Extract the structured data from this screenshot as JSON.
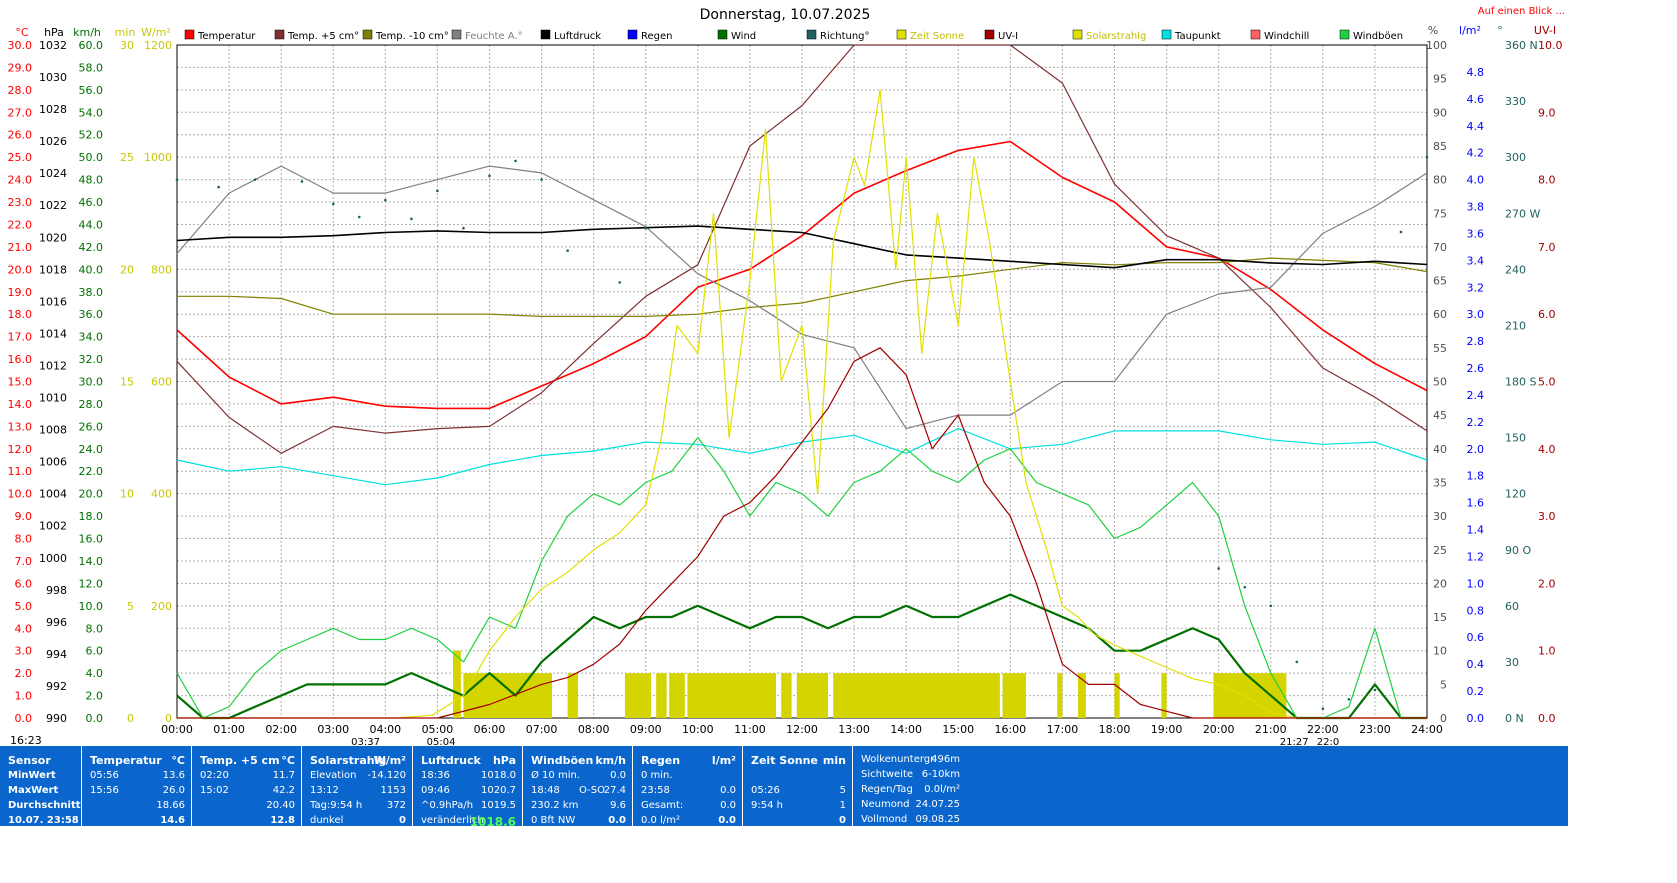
{
  "chart_data": {
    "type": "line",
    "title": "Donnerstag, 10.07.2025",
    "link": "Auf einen Blick ...",
    "time_ticks": [
      "00:00",
      "01:00",
      "02:00",
      "03:00",
      "04:00",
      "05:00",
      "06:00",
      "07:00",
      "08:00",
      "09:00",
      "10:00",
      "11:00",
      "12:00",
      "13:00",
      "14:00",
      "15:00",
      "16:00",
      "17:00",
      "18:00",
      "19:00",
      "20:00",
      "21:00",
      "22:00",
      "23:00",
      "24:00"
    ],
    "axes": {
      "temp": {
        "unit": "°C",
        "min": 0,
        "max": 30,
        "step": 1,
        "color": "#ff0000"
      },
      "pressure": {
        "unit": "hPa",
        "min": 990,
        "max": 1032,
        "step": 2,
        "color": "#000000"
      },
      "wind": {
        "unit": "km/h",
        "min": 0,
        "max": 60,
        "step": 2,
        "color": "#007000"
      },
      "sun_min": {
        "unit": "min",
        "min": 0,
        "max": 30,
        "step": 5,
        "color": "#c8c800"
      },
      "solar": {
        "unit": "W/m²",
        "min": 0,
        "max": 1200,
        "step": 200,
        "color": "#c8c800"
      },
      "humidity": {
        "unit": "%",
        "min": 0,
        "max": 100,
        "step": 5,
        "color": "#505050"
      },
      "rain": {
        "unit": "l/m²",
        "min": 0,
        "max": 5,
        "step": 0.2,
        "color": "#0000ff"
      },
      "direction": {
        "unit": "°",
        "ticks": [
          {
            "v": 0,
            "l": "0 N"
          },
          {
            "v": 30,
            "l": "30"
          },
          {
            "v": 60,
            "l": "60"
          },
          {
            "v": 90,
            "l": "90 O"
          },
          {
            "v": 120,
            "l": "120"
          },
          {
            "v": 150,
            "l": "150"
          },
          {
            "v": 180,
            "l": "180 S"
          },
          {
            "v": 210,
            "l": "210"
          },
          {
            "v": 240,
            "l": "240"
          },
          {
            "v": 270,
            "l": "270 W"
          },
          {
            "v": 300,
            "l": "300"
          },
          {
            "v": 330,
            "l": "330"
          },
          {
            "v": 360,
            "l": "360 N"
          }
        ],
        "color": "#206060"
      },
      "uv": {
        "unit": "UV-I",
        "min": 0,
        "max": 10,
        "step": 1,
        "color": "#a00000"
      }
    },
    "legend": [
      {
        "name": "Temperatur",
        "color": "#ff0000"
      },
      {
        "name": "Temp. +5 cm°",
        "color": "#803030"
      },
      {
        "name": "Temp. -10 cm°",
        "color": "#808000"
      },
      {
        "name": "Feuchte A.°",
        "color": "#808080"
      },
      {
        "name": "Luftdruck",
        "color": "#000000"
      },
      {
        "name": "Regen",
        "color": "#0000ff"
      },
      {
        "name": "Wind",
        "color": "#007000"
      },
      {
        "name": "Richtung°",
        "color": "#206060"
      },
      {
        "name": "Zeit Sonne",
        "color": "#e0e000"
      },
      {
        "name": "UV-I",
        "color": "#a00000"
      },
      {
        "name": "Solarstrahlg",
        "color": "#e0e000"
      },
      {
        "name": "Taupunkt",
        "color": "#00e0e0"
      },
      {
        "name": "Windchill",
        "color": "#ff6060"
      },
      {
        "name": "Windböen",
        "color": "#20d040"
      }
    ],
    "series": [
      {
        "name": "Temperatur",
        "axis": "temp",
        "x": [
          0,
          1,
          2,
          3,
          4,
          5,
          6,
          7,
          8,
          9,
          10,
          11,
          12,
          13,
          14,
          15,
          16,
          17,
          18,
          19,
          20,
          21,
          22,
          23,
          24
        ],
        "values": [
          17.3,
          15.2,
          14.0,
          14.3,
          13.9,
          13.8,
          13.8,
          14.8,
          15.8,
          17.0,
          19.2,
          20.0,
          21.5,
          23.4,
          24.4,
          25.3,
          25.7,
          24.1,
          23.0,
          21.0,
          20.5,
          19.1,
          17.3,
          15.8,
          14.6
        ]
      },
      {
        "name": "Temp. +5 cm°",
        "axis": "temp",
        "x": [
          0,
          1,
          2,
          3,
          4,
          5,
          6,
          7,
          8,
          9,
          10,
          11,
          12,
          13,
          14,
          15,
          16,
          17,
          18,
          19,
          20,
          21,
          22,
          23,
          24
        ],
        "values": [
          15.9,
          13.4,
          11.8,
          13.0,
          12.7,
          12.9,
          13.0,
          14.5,
          16.7,
          18.8,
          20.2,
          25.5,
          27.3,
          30.0,
          30.0,
          30.0,
          30.0,
          28.3,
          23.8,
          21.5,
          20.5,
          18.3,
          15.6,
          14.3,
          12.8
        ]
      },
      {
        "name": "Temp. -10 cm°",
        "axis": "temp",
        "x": [
          0,
          1,
          2,
          3,
          4,
          5,
          6,
          7,
          8,
          9,
          10,
          11,
          12,
          13,
          14,
          15,
          16,
          17,
          18,
          19,
          20,
          21,
          22,
          23,
          24
        ],
        "values": [
          18.8,
          18.8,
          18.7,
          18.0,
          18.0,
          18.0,
          18.0,
          17.9,
          17.9,
          17.9,
          18.0,
          18.3,
          18.5,
          19.0,
          19.5,
          19.7,
          20.0,
          20.3,
          20.2,
          20.3,
          20.3,
          20.5,
          20.4,
          20.3,
          19.9
        ]
      },
      {
        "name": "Feuchte A.°",
        "axis": "humidity",
        "x": [
          0,
          1,
          2,
          3,
          4,
          5,
          6,
          7,
          8,
          9,
          10,
          11,
          12,
          13,
          14,
          15,
          16,
          17,
          18,
          19,
          20,
          21,
          22,
          23,
          24
        ],
        "values": [
          69,
          78,
          82,
          78,
          78,
          80,
          82,
          81,
          77,
          73,
          66,
          62,
          57,
          55,
          43,
          45,
          45,
          50,
          50,
          60,
          63,
          64,
          72,
          76,
          81
        ]
      },
      {
        "name": "Luftdruck",
        "axis": "pressure",
        "x": [
          0,
          1,
          2,
          3,
          4,
          5,
          6,
          7,
          8,
          9,
          10,
          11,
          12,
          13,
          14,
          15,
          16,
          17,
          18,
          19,
          20,
          21,
          22,
          23,
          24
        ],
        "values": [
          1019.8,
          1020.0,
          1020.0,
          1020.1,
          1020.3,
          1020.4,
          1020.3,
          1020.3,
          1020.5,
          1020.6,
          1020.7,
          1020.5,
          1020.3,
          1019.6,
          1018.9,
          1018.7,
          1018.5,
          1018.3,
          1018.1,
          1018.6,
          1018.6,
          1018.4,
          1018.3,
          1018.5,
          1018.3
        ]
      },
      {
        "name": "Taupunkt",
        "axis": "temp",
        "x": [
          0,
          1,
          2,
          3,
          4,
          5,
          6,
          7,
          8,
          9,
          10,
          11,
          12,
          13,
          14,
          15,
          16,
          17,
          18,
          19,
          20,
          21,
          22,
          23,
          24
        ],
        "values": [
          11.5,
          11.0,
          11.2,
          10.8,
          10.4,
          10.7,
          11.3,
          11.7,
          11.9,
          12.3,
          12.2,
          11.8,
          12.3,
          12.6,
          11.8,
          12.9,
          12.0,
          12.2,
          12.8,
          12.8,
          12.8,
          12.4,
          12.2,
          12.3,
          11.5
        ]
      },
      {
        "name": "Wind",
        "axis": "wind",
        "x": [
          0,
          0.5,
          1,
          1.5,
          2,
          2.5,
          3,
          3.5,
          4,
          4.5,
          5,
          5.5,
          6,
          6.5,
          7,
          7.5,
          8,
          8.5,
          9,
          9.5,
          10,
          10.5,
          11,
          11.5,
          12,
          12.5,
          13,
          13.5,
          14,
          14.5,
          15,
          15.5,
          16,
          16.5,
          17,
          17.5,
          18,
          18.5,
          19,
          19.5,
          20,
          20.5,
          21,
          21.5,
          22,
          22.5,
          23,
          23.5,
          24
        ],
        "values": [
          2,
          0,
          0,
          1,
          2,
          3,
          3,
          3,
          3,
          4,
          3,
          2,
          4,
          2,
          5,
          7,
          9,
          8,
          9,
          9,
          10,
          9,
          8,
          9,
          9,
          8,
          9,
          9,
          10,
          9,
          9,
          10,
          11,
          10,
          9,
          8,
          6,
          6,
          7,
          8,
          7,
          4,
          2,
          0,
          0,
          0,
          3,
          0,
          0
        ]
      },
      {
        "name": "Windböen",
        "axis": "wind",
        "x": [
          0,
          0.5,
          1,
          1.5,
          2,
          2.5,
          3,
          3.5,
          4,
          4.5,
          5,
          5.5,
          6,
          6.5,
          7,
          7.5,
          8,
          8.5,
          9,
          9.5,
          10,
          10.5,
          11,
          11.5,
          12,
          12.5,
          13,
          13.5,
          14,
          14.5,
          15,
          15.5,
          16,
          16.5,
          17,
          17.5,
          18,
          18.5,
          19,
          19.5,
          20,
          20.5,
          21,
          21.5,
          22,
          22.5,
          23,
          23.5,
          24
        ],
        "values": [
          4,
          0,
          1,
          4,
          6,
          7,
          8,
          7,
          7,
          8,
          7,
          5,
          9,
          8,
          14,
          18,
          20,
          19,
          21,
          22,
          25,
          22,
          18,
          21,
          20,
          18,
          21,
          22,
          24,
          22,
          21,
          23,
          24,
          21,
          20,
          19,
          16,
          17,
          19,
          21,
          18,
          10,
          4,
          0,
          0,
          1,
          8,
          0,
          0
        ]
      },
      {
        "name": "Solarstrahlg",
        "axis": "solar",
        "x": [
          0,
          4.2,
          4.9,
          5.5,
          6,
          6.5,
          7,
          7.5,
          8,
          8.5,
          9,
          9.3,
          9.6,
          10,
          10.3,
          10.6,
          11,
          11.3,
          11.6,
          12,
          12.3,
          12.6,
          13,
          13.2,
          13.5,
          13.8,
          14,
          14.3,
          14.6,
          15,
          15.3,
          15.6,
          16,
          16.3,
          16.7,
          17,
          17.3,
          17.6,
          18,
          18.5,
          19,
          19.5,
          20,
          20.5,
          21,
          21.5,
          24
        ],
        "values": [
          0,
          0,
          5,
          40,
          120,
          180,
          230,
          260,
          300,
          330,
          380,
          500,
          700,
          650,
          900,
          500,
          780,
          1050,
          600,
          700,
          400,
          850,
          1000,
          950,
          1120,
          800,
          1000,
          650,
          900,
          700,
          1000,
          850,
          600,
          420,
          300,
          200,
          180,
          150,
          130,
          110,
          90,
          70,
          60,
          40,
          10,
          0,
          0
        ]
      },
      {
        "name": "UV-I",
        "axis": "uv",
        "x": [
          0,
          5,
          6,
          7,
          7.5,
          8,
          8.5,
          9,
          9.5,
          10,
          10.5,
          11,
          11.5,
          12,
          12.5,
          13,
          13.5,
          14,
          14.5,
          15,
          15.5,
          16,
          16.5,
          17,
          17.5,
          18,
          18.5,
          19,
          19.5,
          20,
          24
        ],
        "values": [
          0,
          0,
          0.2,
          0.5,
          0.6,
          0.8,
          1.1,
          1.6,
          2.0,
          2.4,
          3.0,
          3.2,
          3.6,
          4.1,
          4.6,
          5.3,
          5.5,
          5.1,
          4.0,
          4.5,
          3.5,
          3.0,
          2.0,
          0.8,
          0.5,
          0.5,
          0.2,
          0.1,
          0,
          0,
          0
        ]
      },
      {
        "name": "Richtung°",
        "axis": "direction",
        "x": [
          0,
          0.8,
          1.5,
          2.4,
          3,
          3.5,
          4,
          4.5,
          5,
          5.5,
          6,
          6.5,
          7,
          7.5,
          8.5,
          9,
          20,
          20.5,
          21,
          21.5,
          22,
          22.5,
          23,
          23.5,
          24
        ],
        "values": [
          288,
          284,
          288,
          287,
          275,
          268,
          277,
          267,
          282,
          262,
          290,
          298,
          288,
          250,
          233,
          262,
          80,
          70,
          60,
          30,
          5,
          10,
          15,
          260,
          300
        ],
        "style": "dots"
      }
    ],
    "sun_bars": [
      [
        5.3,
        5.45,
        3
      ],
      [
        5.5,
        7.2,
        2
      ],
      [
        7.5,
        7.7,
        2
      ],
      [
        8.6,
        9.1,
        2
      ],
      [
        9.2,
        9.4,
        2
      ],
      [
        9.45,
        9.75,
        2
      ],
      [
        9.8,
        11.5,
        2
      ],
      [
        11.6,
        11.8,
        2
      ],
      [
        11.9,
        12.5,
        2
      ],
      [
        12.6,
        15.8,
        2
      ],
      [
        15.85,
        16.3,
        2
      ],
      [
        16.9,
        17.0,
        2
      ],
      [
        17.3,
        17.45,
        2
      ],
      [
        18.0,
        18.1,
        2
      ],
      [
        18.9,
        19.0,
        2
      ],
      [
        19.9,
        21.3,
        2
      ]
    ],
    "sun_bar_value_unit": "min",
    "bottom_markers": {
      "sunrise": "03:37",
      "sun_up": "05:04",
      "sunset": "21:27",
      "moon": "22:0"
    },
    "current_time": "16:23"
  },
  "stats": {
    "sensor": {
      "head": "Sensor",
      "rows": [
        "MinWert",
        "MaxWert",
        "Durchschnitt",
        "10.07. 23:58"
      ]
    },
    "temp": {
      "head": "Temperatur",
      "unit": "°C",
      "rows": [
        {
          "t": "05:56",
          "v": "13.6"
        },
        {
          "t": "15:56",
          "v": "26.0"
        },
        {
          "t": "",
          "v": "18.66"
        },
        {
          "t": "",
          "v": "14.6"
        }
      ]
    },
    "temp5": {
      "head": "Temp. +5 cm",
      "unit": "°C",
      "rows": [
        {
          "t": "02:20",
          "v": "11.7"
        },
        {
          "t": "15:02",
          "v": "42.2"
        },
        {
          "t": "",
          "v": "20.40"
        },
        {
          "t": "",
          "v": "12.8"
        }
      ]
    },
    "solar": {
      "head": "Solarstrahlg",
      "unit": "W/m²",
      "rows": [
        {
          "t": "Elevation",
          "v": "-14.120"
        },
        {
          "t": "13:12",
          "v": "1153"
        },
        {
          "t": "Tag:9:54 h",
          "v": "372"
        },
        {
          "t": "dunkel",
          "v": "0"
        }
      ]
    },
    "pressure": {
      "head": "Luftdruck",
      "unit": "hPa",
      "rows": [
        {
          "t": "18:36",
          "v": "1018.0"
        },
        {
          "t": "09:46",
          "v": "1020.7"
        },
        {
          "t": "^0.9hPa/h",
          "v": "1019.5"
        },
        {
          "t": "veränderlich",
          "v": "1018.6"
        }
      ]
    },
    "gusts": {
      "head": "Windböen",
      "unit": "km/h",
      "rows": [
        {
          "t": "Ø 10 min.",
          "v": "0.0"
        },
        {
          "t": "18:48",
          "m": "O-SO",
          "v": "27.4"
        },
        {
          "t": "230.2 km",
          "v": "9.6"
        },
        {
          "t": "0 Bft NW",
          "v": "0.0"
        }
      ]
    },
    "rain": {
      "head": "Regen",
      "unit": "l/m²",
      "rows": [
        {
          "t": "0 min.",
          "v": ""
        },
        {
          "t": "23:58",
          "v": "0.0"
        },
        {
          "t": "Gesamt:",
          "v": "0.0"
        },
        {
          "t": "0.0 l/m²",
          "v": "0.0"
        }
      ]
    },
    "sun": {
      "head": "Zeit Sonne",
      "unit": "min",
      "rows": [
        {
          "t": "",
          "v": ""
        },
        {
          "t": "05:26",
          "v": "5"
        },
        {
          "t": "9:54 h",
          "v": "1"
        },
        {
          "t": "",
          "v": "0"
        }
      ]
    },
    "misc": {
      "rows": [
        {
          "t": "Wolkenuntergr.",
          "v": "496m"
        },
        {
          "t": "Sichtweite",
          "v": "6-10km"
        },
        {
          "t": "Regen/Tag",
          "v": "0.0l/m²"
        },
        {
          "t": "Neumond",
          "v": "24.07.25"
        },
        {
          "t": "Vollmond",
          "v": "09.08.25"
        }
      ]
    }
  }
}
